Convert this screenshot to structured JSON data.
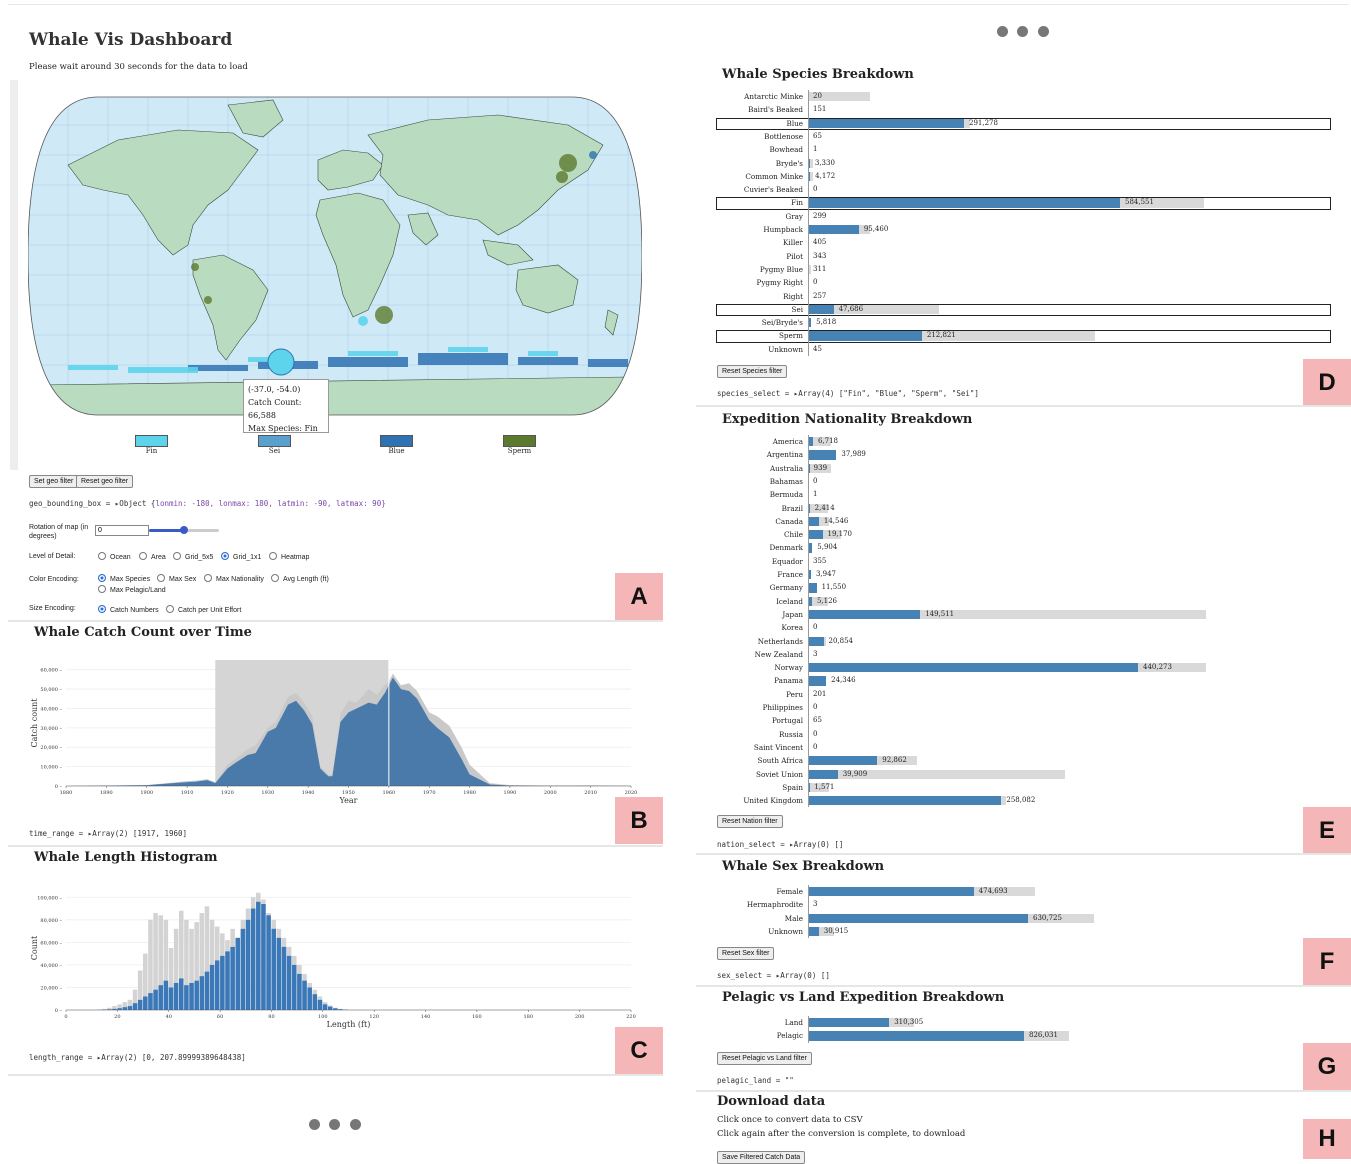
{
  "page": {
    "title": "Whale Vis Dashboard",
    "subtitle": "Please wait around 30 seconds for the data to load"
  },
  "map": {
    "tooltip": {
      "coord": "(-37.0, -54.0)",
      "catch": "Catch Count: 66,588",
      "species": "Max Species: Fin"
    },
    "legend": [
      {
        "label": "Fin",
        "color": "#5ed4ec"
      },
      {
        "label": "Sei",
        "color": "#5aa0cf"
      },
      {
        "label": "Blue",
        "color": "#2f72b3"
      },
      {
        "label": "Sperm",
        "color": "#5c7a2e"
      }
    ]
  },
  "geo": {
    "set_btn": "Set geo filter",
    "reset_btn": "Reset geo filter",
    "bbox_prefix": "geo_bounding_box = ▸Object {",
    "bbox_text": "lonmin: -180, lonmax: 180, latmin: -90, latmax: 90}",
    "rotation_label": "Rotation of map (in degrees)",
    "rotation_value": "0",
    "lod_label": "Level of Detail:",
    "lod_options": [
      "Ocean",
      "Area",
      "Grid_5x5",
      "Grid_1x1",
      "Heatmap"
    ],
    "lod_selected": "Grid_1x1",
    "color_label": "Color Encoding:",
    "color_options": [
      "Max Species",
      "Max Sex",
      "Max Nationality",
      "Avg Length (ft)",
      "Max Pelagic/Land"
    ],
    "color_selected": "Max Species",
    "size_label": "Size Encoding:",
    "size_options": [
      "Catch Numbers",
      "Catch per Unit Effort"
    ],
    "size_selected": "Catch Numbers"
  },
  "time": {
    "title": "Whale Catch Count over Time",
    "ylabel": "Catch count",
    "xlabel": "Year",
    "range_text": "time_range = ▸Array(2) [1917, 1960]"
  },
  "length": {
    "title": "Whale Length Histogram",
    "ylabel": "Count",
    "xlabel": "Length (ft)",
    "range_text": "length_range = ▸Array(2) [0, 207.89999389648438]"
  },
  "species": {
    "title": "Whale Species Breakdown",
    "reset_btn": "Reset Species filter",
    "select_text": "species_select = ▸Array(4) [\"Fin\", \"Blue\", \"Sperm\", \"Sei\"]",
    "items": [
      {
        "label": "Antarctic Minke",
        "val": "20",
        "fg": 0,
        "bg": 20
      },
      {
        "label": "Baird's Beaked",
        "val": "151",
        "fg": 0,
        "bg": 0
      },
      {
        "label": "Blue",
        "val": "291,278",
        "fg": 50,
        "bg": 52,
        "sel": true
      },
      {
        "label": "Bottlenose",
        "val": "65",
        "fg": 0,
        "bg": 0
      },
      {
        "label": "Bowhead",
        "val": "1",
        "fg": 0,
        "bg": 0
      },
      {
        "label": "Bryde's",
        "val": "3,330",
        "fg": 0.6,
        "bg": 1.5
      },
      {
        "label": "Common Minke",
        "val": "4,172",
        "fg": 0.7,
        "bg": 1.6
      },
      {
        "label": "Cuvier's Beaked",
        "val": "0",
        "fg": 0,
        "bg": 0
      },
      {
        "label": "Fin",
        "val": "584,551",
        "fg": 100,
        "bg": 127,
        "sel": true
      },
      {
        "label": "Gray",
        "val": "299",
        "fg": 0,
        "bg": 0
      },
      {
        "label": "Humpback",
        "val": "95,460",
        "fg": 16.3,
        "bg": 20
      },
      {
        "label": "Killer",
        "val": "405",
        "fg": 0,
        "bg": 0
      },
      {
        "label": "Pilot",
        "val": "343",
        "fg": 0,
        "bg": 0
      },
      {
        "label": "Pygmy Blue",
        "val": "311",
        "fg": 0,
        "bg": 1
      },
      {
        "label": "Pygmy Right",
        "val": "0",
        "fg": 0,
        "bg": 0
      },
      {
        "label": "Right",
        "val": "257",
        "fg": 0,
        "bg": 0
      },
      {
        "label": "Sei",
        "val": "47,686",
        "fg": 8.2,
        "bg": 42,
        "sel": true
      },
      {
        "label": "Sei/Bryde's",
        "val": "5,818",
        "fg": 1,
        "bg": 1
      },
      {
        "label": "Sperm",
        "val": "212,821",
        "fg": 36.5,
        "bg": 92,
        "sel": true
      },
      {
        "label": "Unknown",
        "val": "45",
        "fg": 0,
        "bg": 0
      }
    ]
  },
  "nation": {
    "title": "Expedition Nationality Breakdown",
    "reset_btn": "Reset Nation filter",
    "select_text": "nation_select = ▸Array(0) []",
    "items": [
      {
        "label": "America",
        "val": "6,718",
        "fg": 1.5,
        "bg": 7
      },
      {
        "label": "Argentina",
        "val": "37,989",
        "fg": 8.6,
        "bg": 8.6
      },
      {
        "label": "Australia",
        "val": "939",
        "fg": 0.2,
        "bg": 7
      },
      {
        "label": "Bahamas",
        "val": "0",
        "fg": 0,
        "bg": 0
      },
      {
        "label": "Bermuda",
        "val": "1",
        "fg": 0,
        "bg": 0
      },
      {
        "label": "Brazil",
        "val": "2,414",
        "fg": 0.5,
        "bg": 6
      },
      {
        "label": "Canada",
        "val": "14,546",
        "fg": 3.3,
        "bg": 6.5
      },
      {
        "label": "Chile",
        "val": "19,170",
        "fg": 4.4,
        "bg": 10
      },
      {
        "label": "Denmark",
        "val": "5,904",
        "fg": 1.3,
        "bg": 1.3
      },
      {
        "label": "Equador",
        "val": "355",
        "fg": 0,
        "bg": 0
      },
      {
        "label": "France",
        "val": "3,947",
        "fg": 0.9,
        "bg": 0.9
      },
      {
        "label": "Germany",
        "val": "11,550",
        "fg": 2.6,
        "bg": 2.6
      },
      {
        "label": "Iceland",
        "val": "5,126",
        "fg": 1.2,
        "bg": 6
      },
      {
        "label": "Japan",
        "val": "149,511",
        "fg": 34,
        "bg": 120.6
      },
      {
        "label": "Korea",
        "val": "0",
        "fg": 0,
        "bg": 0
      },
      {
        "label": "Netherlands",
        "val": "20,854",
        "fg": 4.7,
        "bg": 5.5
      },
      {
        "label": "New Zealand",
        "val": "3",
        "fg": 0,
        "bg": 0
      },
      {
        "label": "Norway",
        "val": "440,273",
        "fg": 100,
        "bg": 120.6
      },
      {
        "label": "Panama",
        "val": "24,346",
        "fg": 5.5,
        "bg": 5.5
      },
      {
        "label": "Peru",
        "val": "201",
        "fg": 0,
        "bg": 0
      },
      {
        "label": "Philippines",
        "val": "0",
        "fg": 0,
        "bg": 0
      },
      {
        "label": "Portugal",
        "val": "65",
        "fg": 0,
        "bg": 0
      },
      {
        "label": "Russia",
        "val": "0",
        "fg": 0,
        "bg": 0
      },
      {
        "label": "Saint Vincent",
        "val": "0",
        "fg": 0,
        "bg": 0
      },
      {
        "label": "South Africa",
        "val": "92,862",
        "fg": 21,
        "bg": 33
      },
      {
        "label": "Soviet Union",
        "val": "39,909",
        "fg": 9,
        "bg": 78
      },
      {
        "label": "Spain",
        "val": "1,571",
        "fg": 0.4,
        "bg": 6.5
      },
      {
        "label": "United Kingdom",
        "val": "258,082",
        "fg": 58.6,
        "bg": 60
      }
    ]
  },
  "sex": {
    "title": "Whale Sex Breakdown",
    "reset_btn": "Reset Sex filter",
    "select_text": "sex_select = ▸Array(0) []",
    "items": [
      {
        "label": "Female",
        "val": "474,693",
        "fg": 75.3,
        "bg": 103
      },
      {
        "label": "Hermaphrodite",
        "val": "3",
        "fg": 0,
        "bg": 0
      },
      {
        "label": "Male",
        "val": "630,725",
        "fg": 100,
        "bg": 130
      },
      {
        "label": "Unknown",
        "val": "30,915",
        "fg": 4.9,
        "bg": 12
      }
    ]
  },
  "pelagic": {
    "title": "Pelagic vs Land Expedition Breakdown",
    "reset_btn": "Reset Pelagic vs Land filter",
    "select_text": "pelagic_land = \"\"",
    "items": [
      {
        "label": "Land",
        "val": "310,305",
        "fg": 37.6,
        "bg": 49
      },
      {
        "label": "Pelagic",
        "val": "826,031",
        "fg": 100,
        "bg": 121
      }
    ]
  },
  "download": {
    "title": "Download data",
    "line1": "Click once to convert data to CSV",
    "line2": "Click again after the conversion is complete, to download",
    "btn": "Save Filtered Catch Data"
  },
  "badges": [
    "A",
    "B",
    "C",
    "D",
    "E",
    "F",
    "G",
    "H"
  ],
  "colors": {
    "bar": "#4682b4",
    "bar_bg": "#d9d9d9",
    "badge": "#f4b6b6",
    "ocean": "#cfe9f7",
    "land": "#b9dbc0"
  },
  "chart_data": [
    {
      "type": "area",
      "title": "Whale Catch Count over Time",
      "xlabel": "Year",
      "ylabel": "Catch count",
      "xlim": [
        1880,
        2020
      ],
      "ylim": [
        0,
        65000
      ],
      "xticks": [
        "1880",
        "1890",
        "1900",
        "1910",
        "1920",
        "1930",
        "1940",
        "1950",
        "1960",
        "1970",
        "1980",
        "1990",
        "2000",
        "2010",
        "2020"
      ],
      "yticks": [
        "0",
        "10,000",
        "20,000",
        "30,000",
        "40,000",
        "50,000",
        "60,000"
      ],
      "brush": [
        1917,
        1960
      ],
      "x": [
        1880,
        1900,
        1905,
        1910,
        1912,
        1915,
        1917,
        1920,
        1922,
        1925,
        1927,
        1930,
        1932,
        1935,
        1937,
        1939,
        1941,
        1943,
        1945,
        1946,
        1948,
        1950,
        1952,
        1955,
        1957,
        1959,
        1960,
        1961,
        1963,
        1965,
        1967,
        1970,
        1972,
        1975,
        1978,
        1980,
        1985,
        1990,
        2000,
        2010,
        2020
      ],
      "series": [
        {
          "values": [
            0,
            500,
            1500,
            2500,
            2800,
            3500,
            2000,
            11000,
            14000,
            19000,
            21000,
            30000,
            33000,
            46000,
            48000,
            43000,
            36000,
            10000,
            6000,
            5500,
            37000,
            44000,
            43000,
            50000,
            47000,
            52000,
            54000,
            58000,
            52000,
            53000,
            49000,
            38000,
            36000,
            31000,
            20000,
            11000,
            1500,
            500,
            200,
            300,
            100
          ]
        },
        {
          "values": [
            0,
            400,
            1200,
            2000,
            2200,
            3000,
            1500,
            9000,
            12000,
            16000,
            17000,
            28000,
            30000,
            42000,
            44000,
            39000,
            32000,
            9000,
            5000,
            5000,
            33000,
            38000,
            40000,
            43000,
            42000,
            48000,
            52000,
            56000,
            50000,
            49000,
            45000,
            34000,
            30000,
            25000,
            14000,
            6000,
            800,
            200,
            100,
            100,
            0
          ]
        }
      ]
    },
    {
      "type": "bar",
      "title": "Whale Length Histogram",
      "xlabel": "Length (ft)",
      "ylabel": "Count",
      "xlim": [
        0,
        220
      ],
      "ylim": [
        0,
        110000
      ],
      "xticks": [
        "0",
        "20",
        "40",
        "60",
        "80",
        "100",
        "120",
        "140",
        "160",
        "180",
        "200",
        "220"
      ],
      "yticks": [
        "0",
        "20,000",
        "40,000",
        "60,000",
        "80,000",
        "100,000"
      ],
      "bin_start": 10,
      "bin_width": 2,
      "series": [
        {
          "values": [
            200,
            500,
            1000,
            2000,
            3500,
            5000,
            7000,
            9000,
            18000,
            35000,
            50000,
            80000,
            86000,
            84000,
            80000,
            55000,
            72000,
            88000,
            80000,
            72000,
            78000,
            86000,
            92000,
            80000,
            74000,
            68000,
            62000,
            72000,
            64000,
            80000,
            90000,
            100000,
            104000,
            98000,
            86000,
            80000,
            72000,
            64000,
            56000,
            48000,
            40000,
            32000,
            24000,
            18000,
            12000,
            7000,
            4000,
            2000,
            1000,
            500
          ]
        },
        {
          "values": [
            0,
            100,
            300,
            600,
            1000,
            1600,
            2500,
            3500,
            6000,
            9000,
            12000,
            15000,
            18000,
            22000,
            26000,
            20000,
            24000,
            28000,
            22000,
            24000,
            26000,
            30000,
            34000,
            40000,
            44000,
            48000,
            52000,
            56000,
            64000,
            72000,
            80000,
            90000,
            96000,
            94000,
            84000,
            72000,
            64000,
            56000,
            48000,
            40000,
            32000,
            26000,
            20000,
            14000,
            9000,
            5000,
            3000,
            1500,
            700,
            300
          ]
        }
      ]
    }
  ]
}
